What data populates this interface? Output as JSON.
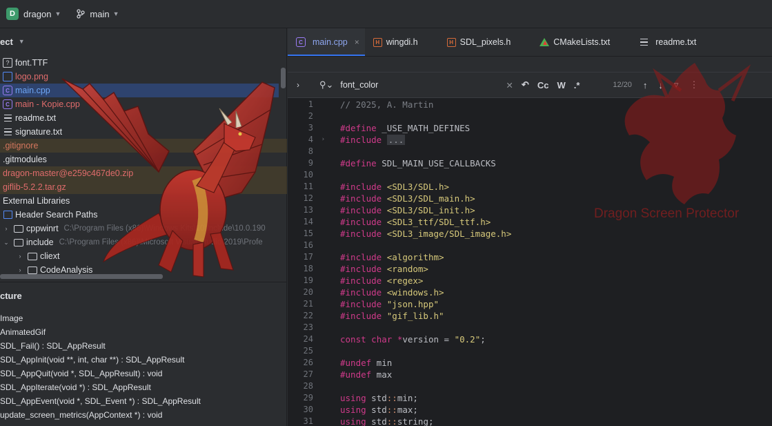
{
  "topbar": {
    "project_badge": "D",
    "project_name": "dragon",
    "branch": "main"
  },
  "project_panel": {
    "title": "ect",
    "tree": [
      {
        "label": "font.TTF",
        "icon": "unknown-file-icon",
        "style": "white"
      },
      {
        "label": "logo.png",
        "icon": "image-file-icon",
        "style": "red"
      },
      {
        "label": "main.cpp",
        "icon": "cpp-file-icon",
        "style": "blue",
        "selected": true
      },
      {
        "label": "main - Kopie.cpp",
        "icon": "cpp-file-icon",
        "style": "red"
      },
      {
        "label": "readme.txt",
        "icon": "text-file-icon",
        "style": "white"
      },
      {
        "label": "signature.txt",
        "icon": "text-file-icon",
        "style": "white"
      },
      {
        "label": ".gitignore",
        "icon": "",
        "style": "orange",
        "ignored": true
      },
      {
        "label": ".gitmodules",
        "icon": "",
        "style": "white"
      },
      {
        "label": "dragon-master@e259c467de0.zip",
        "icon": "",
        "style": "red",
        "ignored": true
      },
      {
        "label": "giflib-5.2.2.tar.gz",
        "icon": "",
        "style": "red",
        "ignored": true
      },
      {
        "label": "External Libraries",
        "icon": "",
        "style": "white"
      },
      {
        "label": "Header Search Paths",
        "icon": "library-icon",
        "style": "white"
      },
      {
        "label": "cppwinrt",
        "path": "C:\\Program Files (x86)\\Windows Kits\\10\\Include\\10.0.190",
        "icon": "folder-icon",
        "arrow": "›",
        "style": "white"
      },
      {
        "label": "include",
        "path": "C:\\Program Files (x86)\\Microsoft Visual Studio\\2019\\Profe",
        "icon": "folder-icon",
        "arrow": "⌄",
        "style": "white"
      },
      {
        "label": "cliext",
        "icon": "folder-icon",
        "arrow": "›",
        "style": "white",
        "indent": 2
      },
      {
        "label": "CodeAnalysis",
        "icon": "folder-icon",
        "arrow": "›",
        "style": "white",
        "indent": 2
      }
    ]
  },
  "structure_panel": {
    "title": "cture",
    "items": [
      "Image",
      "AnimatedGif",
      "SDL_Fail() : SDL_AppResult",
      "SDL_AppInit(void **, int, char **) : SDL_AppResult",
      "SDL_AppQuit(void *, SDL_AppResult) : void",
      "SDL_AppIterate(void *) : SDL_AppResult",
      "SDL_AppEvent(void *, SDL_Event *) : SDL_AppResult",
      "update_screen_metrics(AppContext *) : void"
    ]
  },
  "tabs": [
    {
      "label": "main.cpp",
      "icon": "cpp-file-icon",
      "active": true
    },
    {
      "label": "wingdi.h",
      "icon": "header-file-icon"
    },
    {
      "label": "SDL_pixels.h",
      "icon": "header-file-icon"
    },
    {
      "label": "CMakeLists.txt",
      "icon": "cmake-icon"
    },
    {
      "label": "readme.txt",
      "icon": "text-file-icon"
    }
  ],
  "find": {
    "query": "font_color",
    "count": "12/20",
    "opt_case": "Cc",
    "opt_word": "W",
    "opt_regex": ".*"
  },
  "code_lines": [
    {
      "n": "1",
      "parts": [
        [
          "c-com",
          "// 2025, A. Martin"
        ]
      ]
    },
    {
      "n": "2",
      "parts": []
    },
    {
      "n": "3",
      "parts": [
        [
          "c-pp",
          "#define"
        ],
        [
          "",
          " _USE_MATH_DEFINES"
        ]
      ]
    },
    {
      "n": "4",
      "parts": [
        [
          "c-pp",
          "#include"
        ],
        [
          "",
          " "
        ],
        [
          "c-fold",
          "..."
        ]
      ],
      "fold": "›"
    },
    {
      "n": "8",
      "parts": []
    },
    {
      "n": "9",
      "parts": [
        [
          "c-pp",
          "#define"
        ],
        [
          "",
          " SDL_MAIN_USE_CALLBACKS"
        ]
      ]
    },
    {
      "n": "10",
      "parts": []
    },
    {
      "n": "11",
      "parts": [
        [
          "c-pp",
          "#include"
        ],
        [
          "c-str",
          " <SDL3/SDL.h>"
        ]
      ]
    },
    {
      "n": "12",
      "parts": [
        [
          "c-pp",
          "#include"
        ],
        [
          "c-str",
          " <SDL3/SDL_main.h>"
        ]
      ]
    },
    {
      "n": "13",
      "parts": [
        [
          "c-pp",
          "#include"
        ],
        [
          "c-str",
          " <SDL3/SDL_init.h>"
        ]
      ]
    },
    {
      "n": "14",
      "parts": [
        [
          "c-pp",
          "#include"
        ],
        [
          "c-str",
          " <SDL3_ttf/SDL_ttf.h>"
        ]
      ]
    },
    {
      "n": "15",
      "parts": [
        [
          "c-pp",
          "#include"
        ],
        [
          "c-str",
          " <SDL3_image/SDL_image.h>"
        ]
      ]
    },
    {
      "n": "16",
      "parts": []
    },
    {
      "n": "17",
      "parts": [
        [
          "c-pp",
          "#include"
        ],
        [
          "c-str",
          " <algorithm>"
        ]
      ]
    },
    {
      "n": "18",
      "parts": [
        [
          "c-pp",
          "#include"
        ],
        [
          "c-str",
          " <random>"
        ]
      ]
    },
    {
      "n": "19",
      "parts": [
        [
          "c-pp",
          "#include"
        ],
        [
          "c-str",
          " <regex>"
        ]
      ]
    },
    {
      "n": "20",
      "parts": [
        [
          "c-pp",
          "#include"
        ],
        [
          "c-str",
          " <windows.h>"
        ]
      ]
    },
    {
      "n": "21",
      "parts": [
        [
          "c-pp",
          "#include"
        ],
        [
          "c-str",
          " \"json.hpp\""
        ]
      ]
    },
    {
      "n": "22",
      "parts": [
        [
          "c-pp",
          "#include"
        ],
        [
          "c-str",
          " \"gif_lib.h\""
        ]
      ]
    },
    {
      "n": "23",
      "parts": []
    },
    {
      "n": "24",
      "parts": [
        [
          "c-kw",
          "const"
        ],
        [
          "",
          " "
        ],
        [
          "c-kw",
          "char"
        ],
        [
          "",
          " "
        ],
        [
          "c-kw",
          "*"
        ],
        [
          "",
          "version = "
        ],
        [
          "c-str",
          "\"0.2\""
        ],
        [
          "",
          ";"
        ]
      ]
    },
    {
      "n": "25",
      "parts": []
    },
    {
      "n": "26",
      "parts": [
        [
          "c-pp",
          "#undef"
        ],
        [
          "",
          " min"
        ]
      ]
    },
    {
      "n": "27",
      "parts": [
        [
          "c-pp",
          "#undef"
        ],
        [
          "",
          " max"
        ]
      ]
    },
    {
      "n": "28",
      "parts": []
    },
    {
      "n": "29",
      "parts": [
        [
          "c-kw",
          "using"
        ],
        [
          "",
          " std"
        ],
        [
          "c-ns",
          "::"
        ],
        [
          "",
          "min;"
        ]
      ]
    },
    {
      "n": "30",
      "parts": [
        [
          "c-kw",
          "using"
        ],
        [
          "",
          " std"
        ],
        [
          "c-ns",
          "::"
        ],
        [
          "",
          "max;"
        ]
      ]
    },
    {
      "n": "31",
      "parts": [
        [
          "c-kw",
          "using"
        ],
        [
          "",
          " std"
        ],
        [
          "c-ns",
          "::"
        ],
        [
          "",
          "string;"
        ]
      ]
    }
  ],
  "watermark": {
    "text": "Dragon Screen Protector"
  },
  "colors": {
    "accent": "#3574f0",
    "preprocessor": "#cf3a8a",
    "string": "#d7c97b",
    "comment": "#7a7e85",
    "dragon": "#c0392b"
  }
}
